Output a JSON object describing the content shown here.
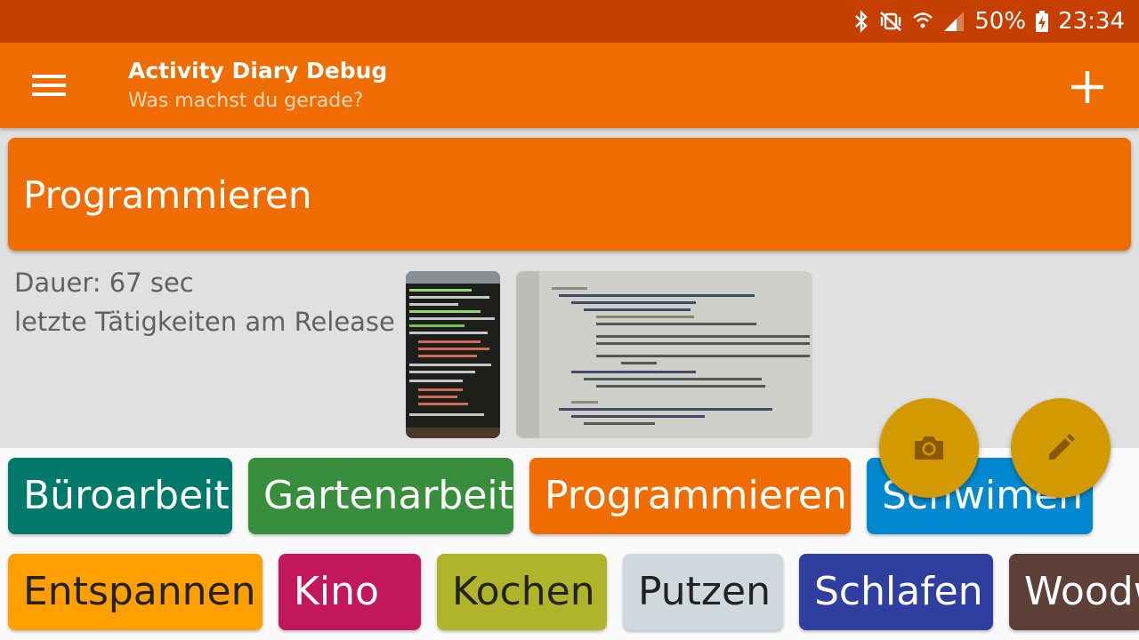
{
  "status_bar": {
    "battery": "50%",
    "time": "23:34"
  },
  "app_bar": {
    "title": "Activity Diary Debug",
    "subtitle": "Was machst du gerade?",
    "menu_icon": "hamburger-menu-icon",
    "add_icon": "plus-icon"
  },
  "current_activity": {
    "name": "Programmieren",
    "color": "#ef6c00",
    "duration": "Dauer: 67 sec",
    "note": "letzte Tätigkeiten am Release",
    "photos": [
      "terminal-photo",
      "code-screen-photo"
    ]
  },
  "fabs": {
    "camera_icon": "camera-icon",
    "edit_icon": "pencil-icon",
    "color": "#d39a00"
  },
  "activities": [
    {
      "label": "Büroarbeit",
      "color": "#00796b"
    },
    {
      "label": "Gartenarbeit",
      "color": "#388e3c"
    },
    {
      "label": "Programmieren",
      "color": "#ef6c00"
    },
    {
      "label": "Schwimen",
      "color": "#0288d1"
    },
    {
      "label": "Entspannen",
      "color": "#ffa000"
    },
    {
      "label": "Kino",
      "color": "#c2185b"
    },
    {
      "label": "Kochen",
      "color": "#afb42b"
    },
    {
      "label": "Putzen",
      "color": "#cfd8dc"
    },
    {
      "label": "Schlafen",
      "color": "#303f9f"
    },
    {
      "label": "Woodw",
      "color": "#5d4037"
    }
  ]
}
